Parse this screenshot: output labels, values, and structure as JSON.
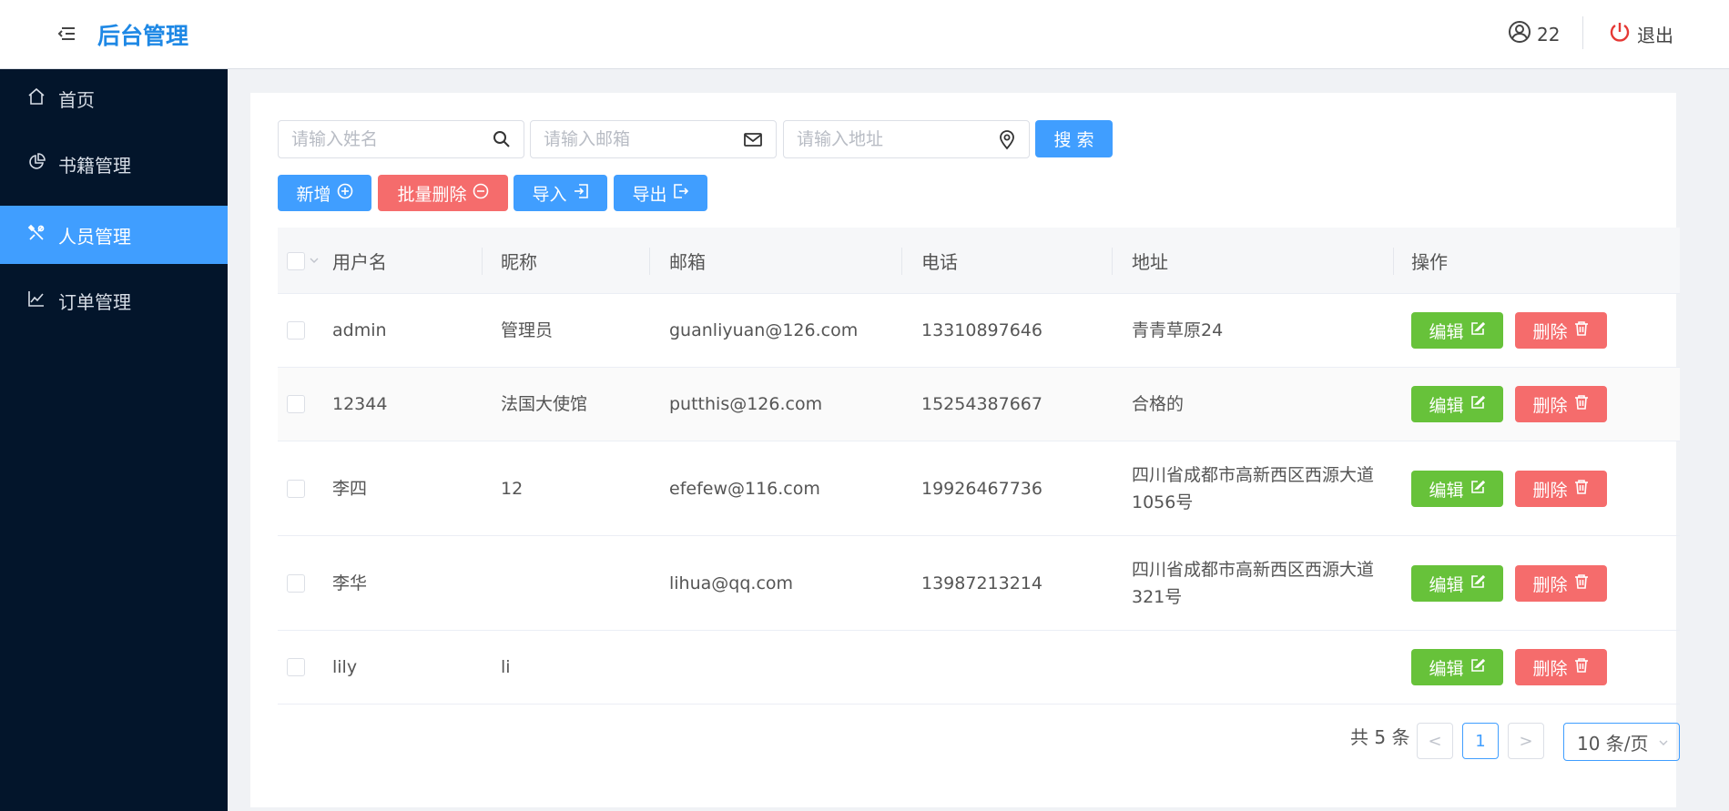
{
  "header": {
    "brand": "后台管理",
    "user_count": "22",
    "logout_label": "退出"
  },
  "sidebar": {
    "items": [
      {
        "label": "首页",
        "icon": "home-icon",
        "active": false
      },
      {
        "label": "书籍管理",
        "icon": "pie-chart-icon",
        "active": false
      },
      {
        "label": "人员管理",
        "icon": "tools-icon",
        "active": true
      },
      {
        "label": "订单管理",
        "icon": "line-chart-icon",
        "active": false
      }
    ]
  },
  "search": {
    "name_placeholder": "请输入姓名",
    "email_placeholder": "请输入邮箱",
    "address_placeholder": "请输入地址",
    "search_label": "搜 索"
  },
  "toolbar": {
    "add_label": "新增",
    "batch_delete_label": "批量删除",
    "import_label": "导入",
    "export_label": "导出"
  },
  "table": {
    "columns": [
      "用户名",
      "昵称",
      "邮箱",
      "电话",
      "地址",
      "操作"
    ],
    "rows": [
      {
        "username": "admin",
        "nickname": "管理员",
        "email": "guanliyuan@126.com",
        "phone": "13310897646",
        "address": "青青草原24"
      },
      {
        "username": "12344",
        "nickname": "法国大使馆",
        "email": "putthis@126.com",
        "phone": "15254387667",
        "address": "合格的"
      },
      {
        "username": "李四",
        "nickname": "12",
        "email": "efefew@116.com",
        "phone": "19926467736",
        "address": "四川省成都市高新西区西源大道1056号"
      },
      {
        "username": "李华",
        "nickname": "",
        "email": "lihua@qq.com",
        "phone": "13987213214",
        "address": "四川省成都市高新西区西源大道321号"
      },
      {
        "username": "lily",
        "nickname": "li",
        "email": "",
        "phone": "",
        "address": ""
      }
    ],
    "edit_label": "编辑",
    "delete_label": "删除"
  },
  "pagination": {
    "total_text": "共 5 条",
    "current_page": "1",
    "page_size": "10 条/页",
    "prev_glyph": "<",
    "next_glyph": ">"
  },
  "colors": {
    "primary": "#409eff",
    "danger": "#f56c6c",
    "success": "#67c23a",
    "sidebar_bg": "#03152b",
    "brand": "#1e88e5"
  }
}
